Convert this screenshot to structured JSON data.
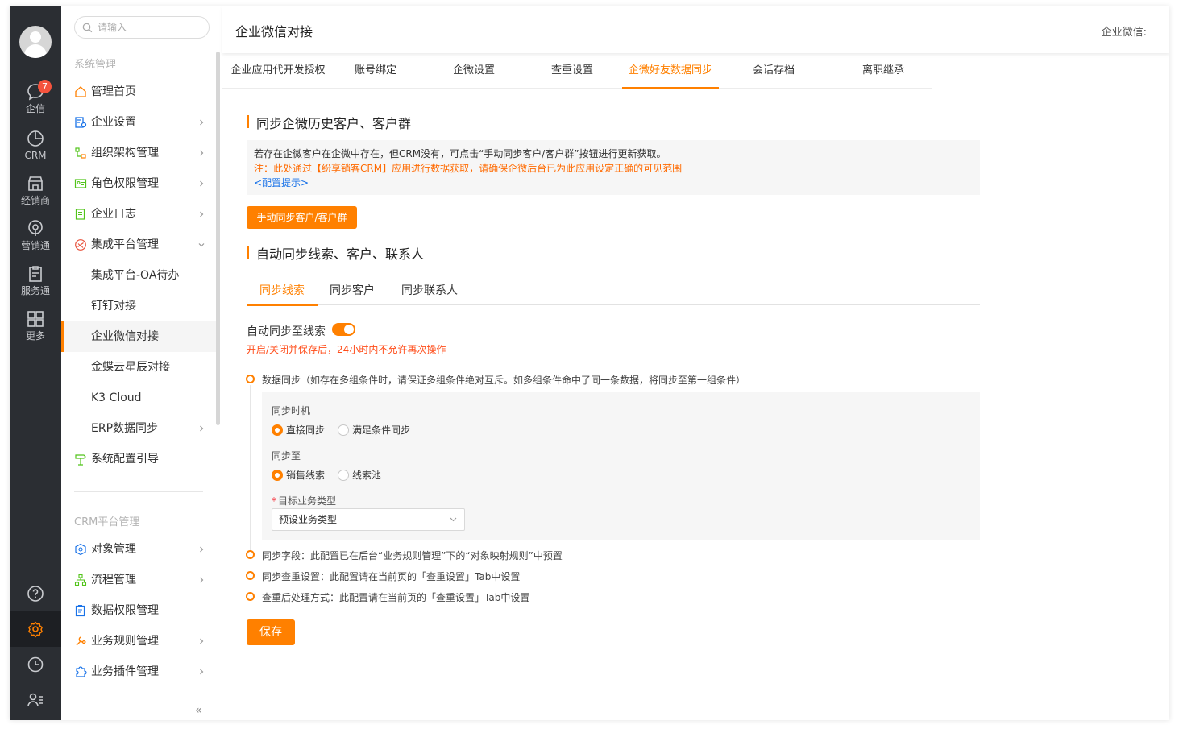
{
  "rail": {
    "items": [
      {
        "label": "企信",
        "badge": "7"
      },
      {
        "label": "CRM"
      },
      {
        "label": "经销商"
      },
      {
        "label": "营销通"
      },
      {
        "label": "服务通"
      },
      {
        "label": "更多"
      }
    ],
    "bottom_icons": [
      "help-icon",
      "settings-icon",
      "clock-icon",
      "user-list-icon"
    ]
  },
  "sidebar": {
    "search_placeholder": "请输入",
    "group1": "系统管理",
    "items": [
      {
        "label": "管理首页",
        "icon": "home-icon"
      },
      {
        "label": "企业设置",
        "icon": "enterprise-settings-icon"
      },
      {
        "label": "组织架构管理",
        "icon": "org-structure-icon"
      },
      {
        "label": "角色权限管理",
        "icon": "role-permission-icon"
      },
      {
        "label": "企业日志",
        "icon": "log-icon"
      },
      {
        "label": "集成平台管理",
        "icon": "integration-icon"
      },
      {
        "label": "集成平台-OA待办"
      },
      {
        "label": "钉钉对接"
      },
      {
        "label": "企业微信对接"
      },
      {
        "label": "金蝶云星辰对接"
      },
      {
        "label": "K3 Cloud"
      },
      {
        "label": "ERP数据同步"
      },
      {
        "label": "系统配置引导",
        "icon": "config-guide-icon"
      }
    ],
    "group2": "CRM平台管理",
    "items2": [
      {
        "label": "对象管理",
        "icon": "object-icon"
      },
      {
        "label": "流程管理",
        "icon": "flow-icon"
      },
      {
        "label": "数据权限管理",
        "icon": "data-permission-icon"
      },
      {
        "label": "业务规则管理",
        "icon": "rule-icon"
      },
      {
        "label": "业务插件管理",
        "icon": "plugin-icon"
      }
    ],
    "collapse_label": "«"
  },
  "header": {
    "title": "企业微信对接",
    "right": "企业微信:"
  },
  "tabs": [
    "企业应用代开发授权",
    "账号绑定",
    "企微设置",
    "查重设置",
    "企微好友数据同步",
    "会话存档",
    "离职继承"
  ],
  "active_tab": "企微好友数据同步",
  "section1": {
    "title": "同步企微历史客户、客户群",
    "line1": "若存在企微客户在企微中存在，但CRM没有，可点击“手动同步客户/客户群”按钮进行更新获取。",
    "line2": "注：此处通过【纷享销客CRM】应用进行数据获取，请确保企微后台已为此应用设定正确的可见范围",
    "line3": "<配置提示>",
    "button": "手动同步客户/客户群"
  },
  "section2": {
    "title": "自动同步线索、客户、联系人",
    "subtabs": [
      "同步线索",
      "同步客户",
      "同步联系人"
    ],
    "toggle_label": "自动同步至线索",
    "toggle_on": true,
    "warning": "开启/关闭并保存后，24小时内不允许再次操作",
    "timeline": [
      "数据同步（如存在多组条件时，请保证多组条件绝对互斥。如多组条件命中了同一条数据，将同步至第一组条件）",
      "同步字段：此配置已在后台“业务规则管理”下的“对象映射规则”中预置",
      "同步查重设置：此配置请在当前页的「查重设置」Tab中设置",
      "查重后处理方式：此配置请在当前页的「查重设置」Tab中设置"
    ],
    "sync_timing_label": "同步时机",
    "sync_timing_options": [
      "直接同步",
      "满足条件同步"
    ],
    "sync_timing_selected": "直接同步",
    "sync_to_label": "同步至",
    "sync_to_options": [
      "销售线索",
      "线索池"
    ],
    "sync_to_selected": "销售线索",
    "target_type_label": "目标业务类型",
    "target_type_required": "*",
    "target_type_value": "预设业务类型",
    "save": "保存"
  },
  "colors": {
    "accent": "#ff8000",
    "rail": "#2b2e33",
    "warning": "#ff4d1a",
    "link": "#1a73e8"
  }
}
